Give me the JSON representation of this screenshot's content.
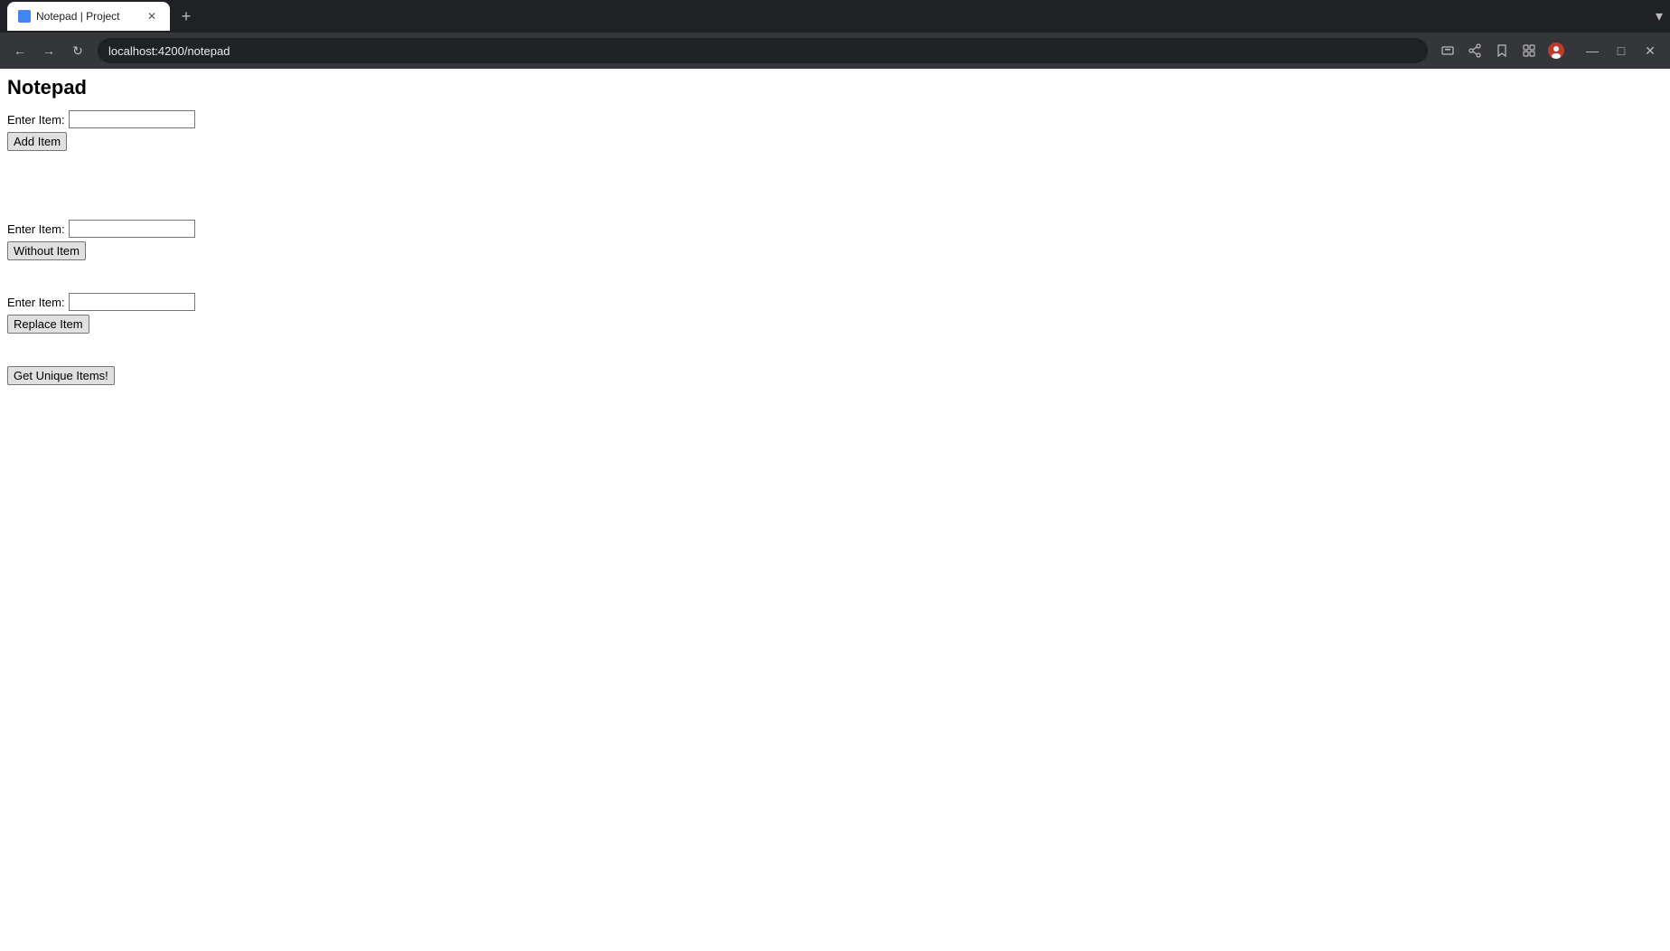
{
  "browser": {
    "tab_title": "Notepad | Project",
    "tab_favicon": "N",
    "new_tab_label": "+",
    "dropdown_label": "▾",
    "back_label": "←",
    "forward_label": "→",
    "reload_label": "↻",
    "address": "localhost:4200/notepad",
    "window_minimize": "—",
    "window_maximize": "□",
    "window_close": "✕"
  },
  "page": {
    "title": "Notepad",
    "section1": {
      "label": "Enter Item:",
      "button": "Add Item"
    },
    "section2": {
      "label": "Enter Item:",
      "button": "Without Item"
    },
    "section3": {
      "label": "Enter Item:",
      "button": "Replace Item"
    },
    "section4": {
      "button": "Get Unique Items!"
    }
  }
}
